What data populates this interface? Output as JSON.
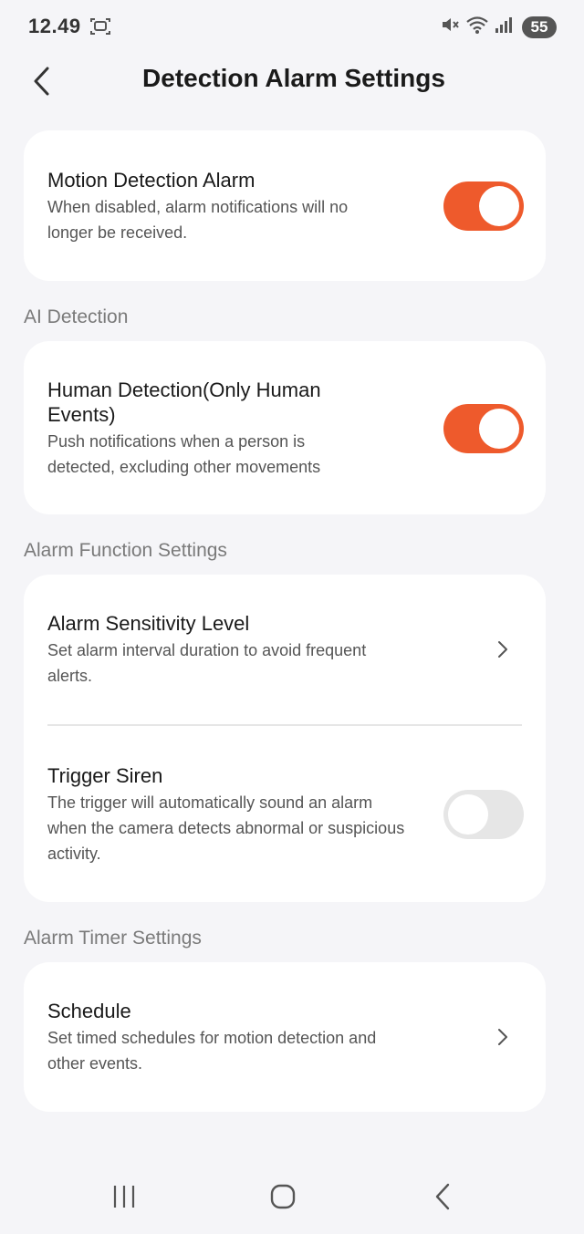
{
  "status_bar": {
    "time": "12.49",
    "battery": "55",
    "icons": [
      "screenshot-icon",
      "mute-icon",
      "wifi-icon",
      "signal-icon"
    ]
  },
  "header": {
    "title": "Detection Alarm Settings",
    "back_icon": "chevron-left-icon"
  },
  "colors": {
    "accent": "#ee5a2c",
    "background": "#f5f5f8",
    "card": "#ffffff",
    "toggle_off": "#e6e6e6"
  },
  "motion_alarm": {
    "title": "Motion Detection Alarm",
    "desc": "When disabled, alarm notifications will no longer be received.",
    "enabled": true
  },
  "ai_detection": {
    "section_label": "AI Detection",
    "human_detection": {
      "title": "Human Detection(Only Human Events)",
      "desc": "Push notifications when a person is detected, excluding other movements",
      "enabled": true
    }
  },
  "alarm_function": {
    "section_label": "Alarm Function Settings",
    "sensitivity": {
      "title": "Alarm Sensitivity Level",
      "desc": "Set alarm interval duration to avoid frequent alerts."
    },
    "trigger_siren": {
      "title": "Trigger Siren",
      "desc": "The trigger will automatically sound an alarm when the camera detects abnormal or suspicious activity.",
      "enabled": false
    }
  },
  "alarm_timer": {
    "section_label": "Alarm Timer Settings",
    "schedule": {
      "title": "Schedule",
      "desc": "Set timed schedules for motion detection and other events."
    }
  },
  "nav_bar": {
    "icons": [
      "recent-apps-icon",
      "home-icon",
      "back-icon"
    ]
  }
}
